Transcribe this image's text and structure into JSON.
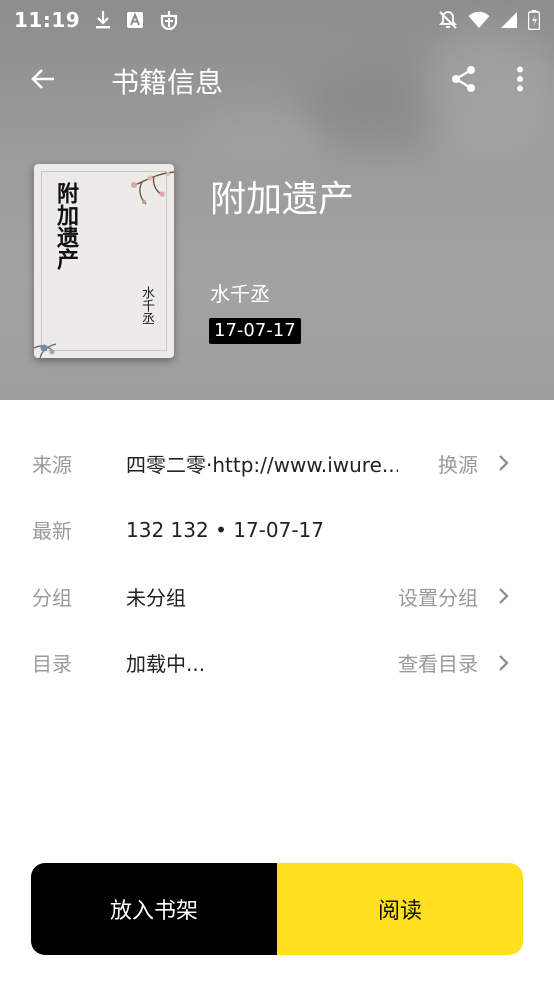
{
  "status_bar": {
    "time": "11:19",
    "left_icons": [
      "download-icon",
      "font-icon",
      "bug-icon"
    ],
    "right_icons": [
      "notifications-off-icon",
      "wifi-icon",
      "signal-icon",
      "battery-icon"
    ]
  },
  "app_bar": {
    "title": "书籍信息",
    "actions": [
      "share-icon",
      "more-vert-icon"
    ]
  },
  "book": {
    "cover_title": "附加遗产",
    "cover_author": "水千丞",
    "name": "附加遗产",
    "author": "水千丞",
    "date": "17-07-17"
  },
  "info": {
    "source": {
      "label": "来源",
      "value": "四零二零·http://www.iwure...",
      "action": "换源"
    },
    "latest": {
      "label": "最新",
      "value": "132 132 • 17-07-17"
    },
    "group": {
      "label": "分组",
      "value": "未分组",
      "action": "设置分组"
    },
    "toc": {
      "label": "目录",
      "value": "加载中...",
      "action": "查看目录"
    }
  },
  "buttons": {
    "add_to_shelf": "放入书架",
    "read": "阅读"
  },
  "colors": {
    "accent_yellow": "#ffe01f",
    "shelf_button": "#000000",
    "label_gray": "#9a9a9a"
  }
}
